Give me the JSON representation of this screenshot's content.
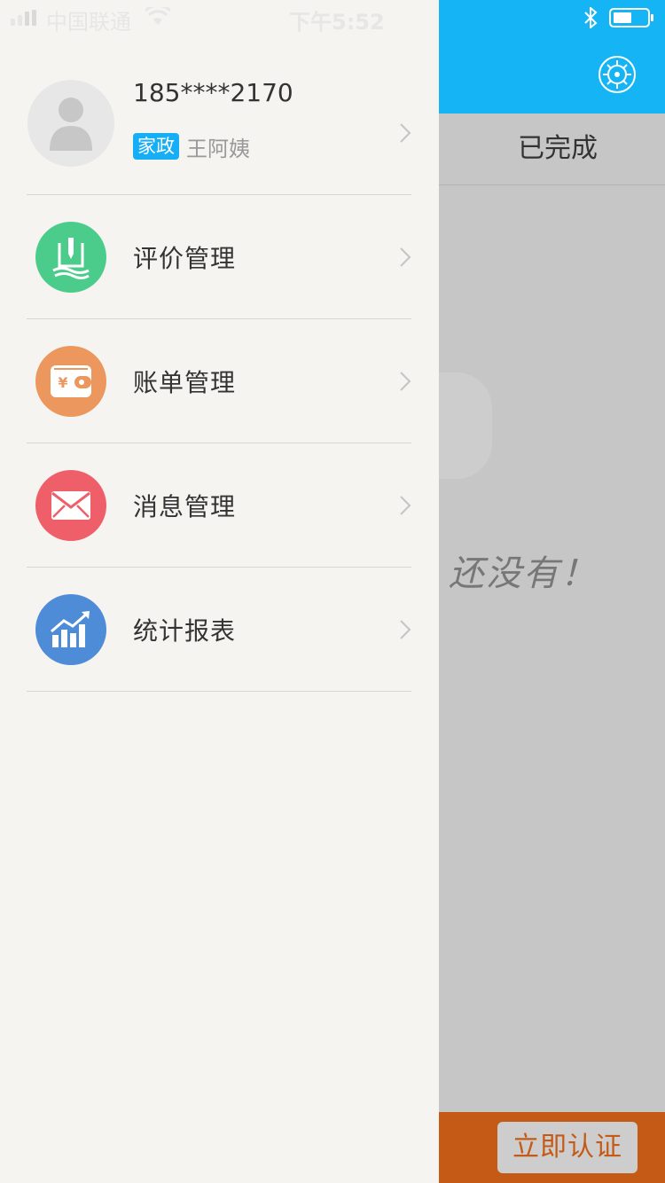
{
  "status_bar": {
    "carrier": "中国联通",
    "time": "下午5:52"
  },
  "profile": {
    "phone": "185****2170",
    "tag": "家政",
    "name": "王阿姨"
  },
  "menu": [
    {
      "label": "评价管理",
      "icon": "review-icon",
      "color": "#4ccc8b"
    },
    {
      "label": "账单管理",
      "icon": "wallet-icon",
      "color": "#eb975d"
    },
    {
      "label": "消息管理",
      "icon": "mail-icon",
      "color": "#ef5f6a"
    },
    {
      "label": "统计报表",
      "icon": "chart-icon",
      "color": "#4f8cd8"
    }
  ],
  "underlay": {
    "tab_done": "已完成",
    "empty_text": "还没有！",
    "certify_button": "立即认证",
    "header_color": "#15b5f5",
    "bottom_bar_color": "#c55a17"
  }
}
